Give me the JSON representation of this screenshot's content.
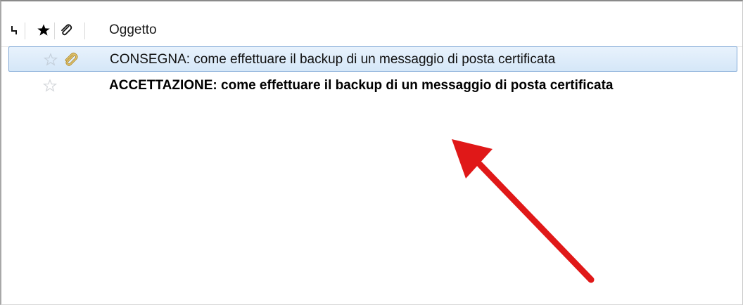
{
  "columns": {
    "thread_icon": "thread-icon",
    "star_icon": "star-icon",
    "attachment_icon": "attachment-icon",
    "subject_label": "Oggetto"
  },
  "messages": [
    {
      "subject": "CONSEGNA: come effettuare il backup di un messaggio di posta certificata",
      "starred": false,
      "has_attachment": true,
      "unread": false,
      "selected": true
    },
    {
      "subject": "ACCETTAZIONE: come effettuare il backup di un messaggio di posta certificata",
      "starred": false,
      "has_attachment": false,
      "unread": true,
      "selected": false
    }
  ],
  "colors": {
    "selection_bg": "#d5e7f8",
    "selection_border": "#7fa8d6",
    "annotation_arrow": "#e01818",
    "attachment_icon": "#c9a64a"
  }
}
